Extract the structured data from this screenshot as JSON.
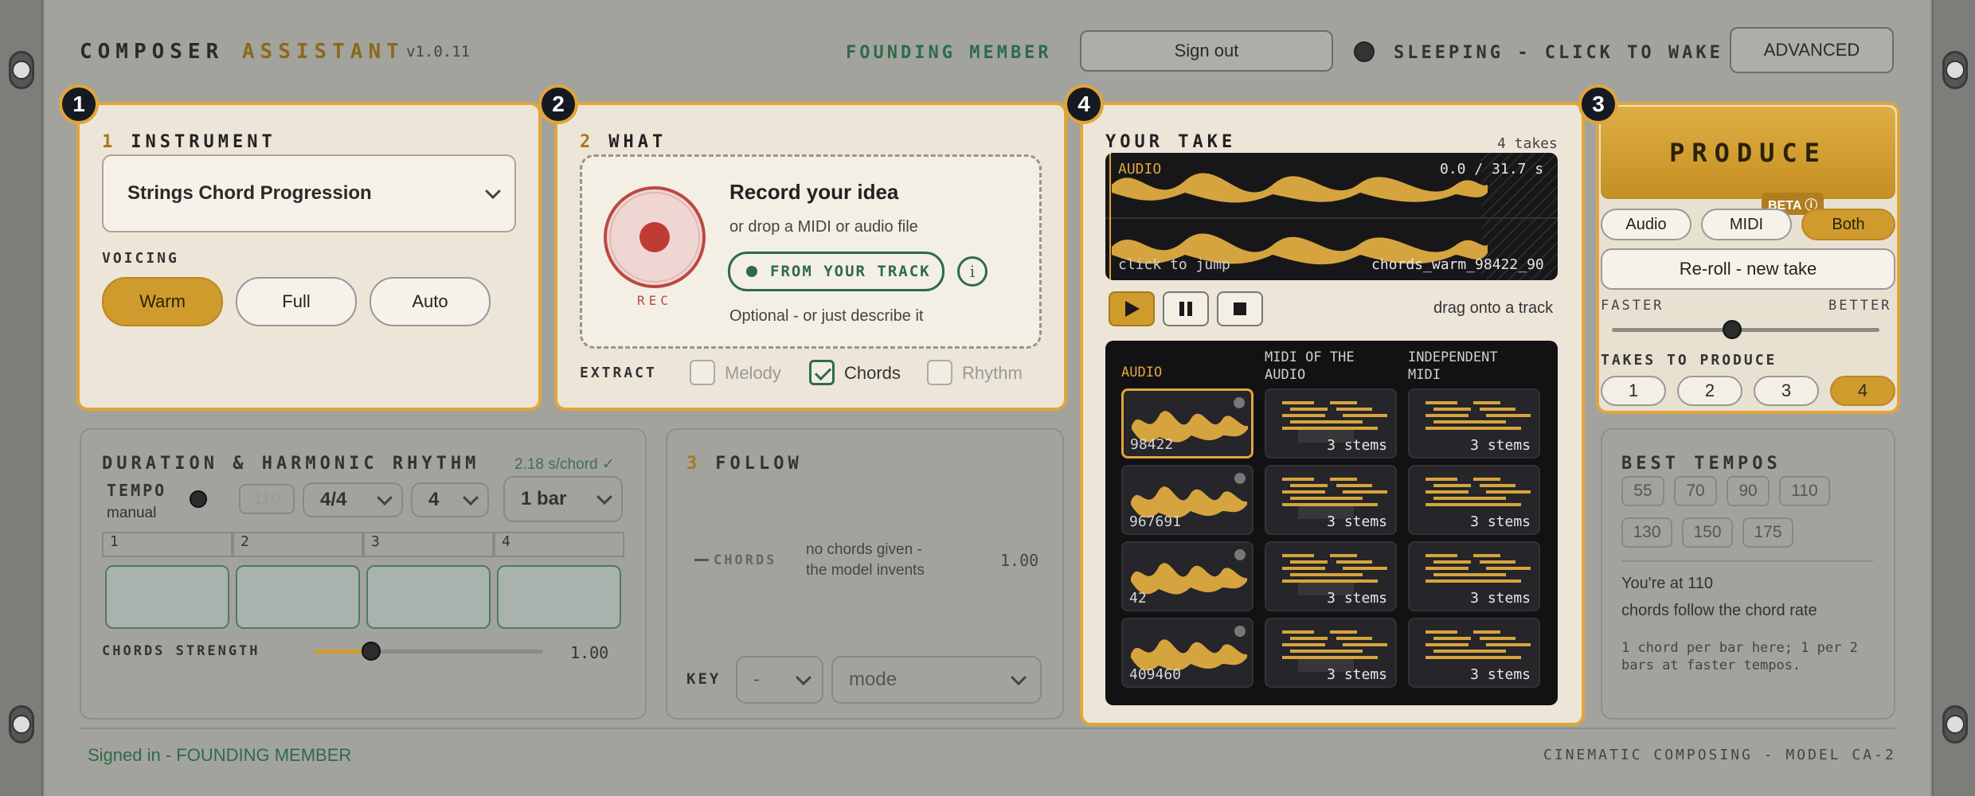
{
  "header": {
    "brand_a": "COMPOSER",
    "brand_b": "ASSISTANT",
    "version": "v1.0.11",
    "member": "FOUNDING MEMBER",
    "sign_out": "Sign out",
    "status": "SLEEPING - CLICK TO WAKE",
    "advanced": "ADVANCED"
  },
  "badges": [
    "1",
    "2",
    "4",
    "3"
  ],
  "instrument": {
    "num": "1",
    "title": "INSTRUMENT",
    "selected": "Strings Chord Progression",
    "voicing_label": "VOICING",
    "voicings": [
      "Warm",
      "Full",
      "Auto"
    ],
    "active_voicing": "Warm"
  },
  "what": {
    "num": "2",
    "title": "WHAT",
    "rec_label": "REC",
    "heading": "Record your idea",
    "sub": "or drop a MIDI or audio file",
    "from_track": "FROM YOUR TRACK",
    "info": "i",
    "optional": "Optional - or just describe it",
    "extract_label": "EXTRACT",
    "extract": [
      {
        "label": "Melody",
        "checked": false
      },
      {
        "label": "Chords",
        "checked": true
      },
      {
        "label": "Rhythm",
        "checked": false
      }
    ]
  },
  "take": {
    "title": "YOUR TAKE",
    "count": "4 takes",
    "audio_tag": "AUDIO",
    "time": "0.0 / 31.7 s",
    "click_hint": "click to jump",
    "file": "chords_warm_98422_90",
    "drag_hint": "drag onto a track",
    "grid_headers": [
      "AUDIO",
      "MIDI OF THE AUDIO",
      "INDEPENDENT MIDI"
    ],
    "rows": [
      {
        "id": "98422",
        "midi": "3 stems",
        "indep": "3 stems"
      },
      {
        "id": "967691",
        "midi": "3 stems",
        "indep": "3 stems"
      },
      {
        "id": "42",
        "midi": "3 stems",
        "indep": "3 stems"
      },
      {
        "id": "409460",
        "midi": "3 stems",
        "indep": "3 stems"
      }
    ]
  },
  "produce": {
    "label": "PRODUCE",
    "beta": "BETA ⓘ",
    "formats": [
      "Audio",
      "MIDI",
      "Both"
    ],
    "active_format": "Both",
    "reroll": "Re-roll - new take",
    "faster": "FASTER",
    "better": "BETTER",
    "speed_quality": 0.45,
    "takes_label": "TAKES TO PRODUCE",
    "takes": [
      "1",
      "2",
      "3",
      "4"
    ],
    "active_takes": "4"
  },
  "duration": {
    "title": "DURATION & HARMONIC RHYTHM",
    "rate": "2.18 s/chord ✓",
    "tempo_label": "TEMPO",
    "tempo_mode": "manual",
    "tempo_value": "110",
    "time_sig": "4/4",
    "beats": "4",
    "length": "1 bar",
    "bars": [
      "1",
      "2",
      "3",
      "4"
    ],
    "strength_label": "CHORDS STRENGTH",
    "strength_value": "1.00",
    "strength_pos": 0.25
  },
  "follow": {
    "num": "3",
    "title": "FOLLOW",
    "chords_label": "CHORDS",
    "chords_note_1": "no chords given -",
    "chords_note_2": "the model invents",
    "chords_value": "1.00",
    "key_label": "KEY",
    "key_value": "-",
    "mode_value": "mode"
  },
  "tempos": {
    "title": "BEST TEMPOS",
    "values": [
      "55",
      "70",
      "90",
      "110",
      "130",
      "150",
      "175"
    ],
    "at": "You're at 110",
    "follow": "chords follow the chord rate",
    "note_1": "1 chord per bar here; 1 per 2",
    "note_2": "bars at faster tempos."
  },
  "footer": {
    "signed_in": "Signed in - FOUNDING MEMBER",
    "model": "CINEMATIC COMPOSING - MODEL CA-2"
  }
}
